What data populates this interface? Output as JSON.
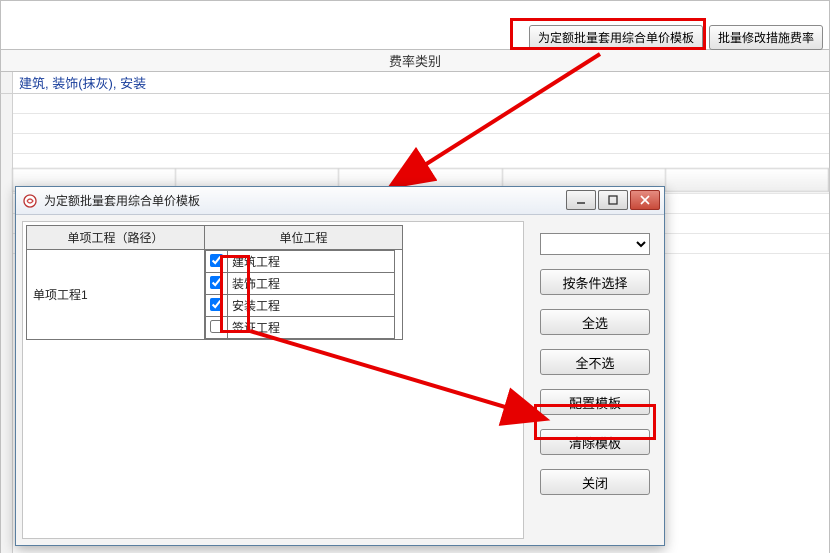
{
  "toolbar": {
    "apply_template_btn": "为定额批量套用综合单价模板",
    "modify_rate_btn": "批量修改措施费率"
  },
  "grid": {
    "header": "费率类别",
    "row1": "建筑, 装饰(抹灰), 安装"
  },
  "dialog": {
    "title": "为定额批量套用综合单价模板",
    "table": {
      "col1_header": "单项工程（路径）",
      "col2_header": "单位工程",
      "left_cell": "单项工程1",
      "items": [
        {
          "label": "建筑工程",
          "checked": true
        },
        {
          "label": "装饰工程",
          "checked": true
        },
        {
          "label": "安装工程",
          "checked": true
        },
        {
          "label": "签证工程",
          "checked": false
        }
      ]
    },
    "buttons": {
      "select_by_condition": "按条件选择",
      "select_all": "全选",
      "select_none": "全不选",
      "configure_template": "配置模板",
      "clear_template": "清除模板",
      "close": "关闭"
    }
  }
}
